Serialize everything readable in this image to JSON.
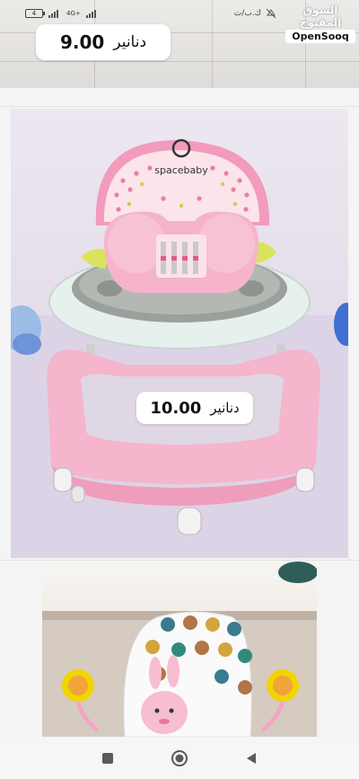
{
  "status_bar": {
    "battery": "4",
    "network": "4G+",
    "carrier_text": "ك.ب/ت"
  },
  "brand": {
    "arabic": "السوق المفتوح",
    "english": "OpenSooq"
  },
  "listings": [
    {
      "price": "9.00",
      "currency": "دنانير"
    },
    {
      "price": "10.00",
      "currency": "دنانير"
    }
  ],
  "product_brand_text": "spacebaby",
  "nav": {
    "back_icon": "triangle-back-icon",
    "home_icon": "circle-home-icon",
    "recents_icon": "square-recents-icon"
  },
  "colors": {
    "walker_pink": "#f5b5cd",
    "tray_white": "#e6f1ee",
    "tray_grey": "#9aa19c",
    "seat_pink": "#f7c8d8"
  }
}
